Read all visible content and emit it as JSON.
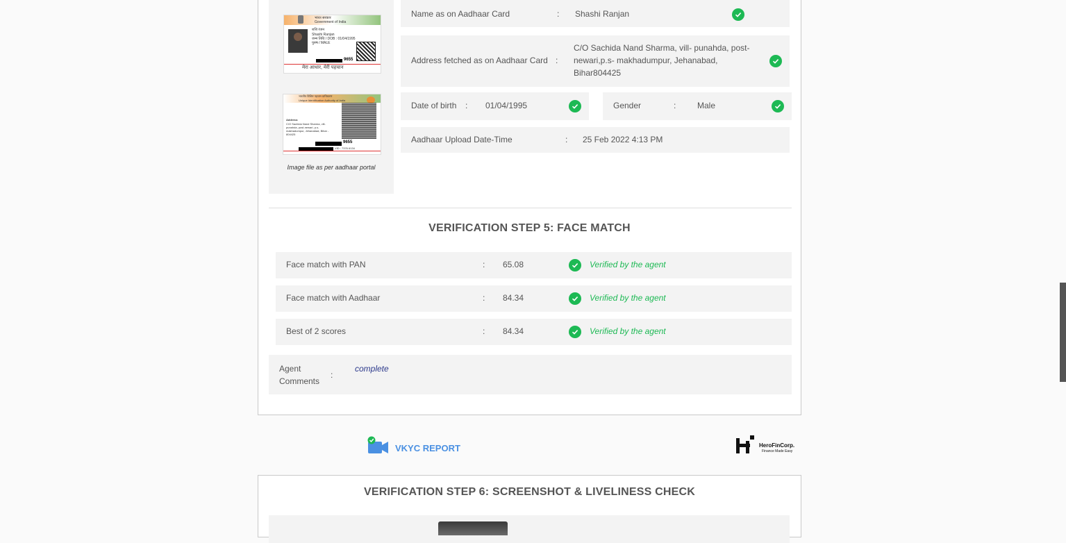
{
  "aadhaar": {
    "name_label": "Name as on Aadhaar Card",
    "name_value": "Shashi Ranjan",
    "address_label": "Address fetched as on Aadhaar Card",
    "address_value": "C/O Sachida Nand Sharma, vill- punahda, post-newari,p.s- makhadumpur, Jehanabad, Bihar804425",
    "dob_label": "Date of birth",
    "dob_value": "01/04/1995",
    "gender_label": "Gender",
    "gender_value": "Male",
    "upload_label": "Aadhaar Upload Date-Time",
    "upload_value": "25 Feb 2022 4:13 PM",
    "image_caption": "Image file as per aadhaar portal",
    "card_front": {
      "line1": "भारत सरकार",
      "line2": "Government of India",
      "name_hi": "शशि रंजन",
      "name_en": "Shashi Ranjan",
      "dob": "जन्म तिथि / DOB : 01/04/1995",
      "gender": "पुरुष / MALE",
      "number": "9655",
      "tagline": "मेरा आधार, मेरी पहचान"
    },
    "card_back": {
      "header1": "भारतीय विशिष्ट पहचान प्राधिकरण",
      "header2": "Unique Identification Authority of India",
      "address_title": "Address:",
      "address": "C/O Sachida Nand Sharma, vill-punahda, post-newari, p.s-makhadumpur, Jehanabad, Bihar - 804425",
      "number": "9655",
      "vid": "VID : 7376 6134"
    }
  },
  "face_match": {
    "heading": "VERIFICATION STEP 5: FACE MATCH",
    "rows": [
      {
        "label": "Face match with PAN",
        "value": "65.08",
        "status": "Verified by the agent"
      },
      {
        "label": "Face match with Aadhaar",
        "value": "84.34",
        "status": "Verified by the agent"
      },
      {
        "label": "Best of 2 scores",
        "value": "84.34",
        "status": "Verified by the agent"
      }
    ],
    "comments_label_1": "Agent",
    "comments_label_2": "Comments",
    "comments_value": "complete"
  },
  "footer": {
    "report_label": "VKYC REPORT",
    "brand_name": "HeroFinCorp.",
    "brand_tagline": "Finance Made Easy"
  },
  "step6": {
    "heading": "VERIFICATION STEP 6: SCREENSHOT & LIVELINESS CHECK"
  },
  "colon": ":",
  "colors": {
    "accent_green": "#1db954",
    "report_blue": "#4a90e2",
    "comment_blue": "#2d3a8c"
  }
}
